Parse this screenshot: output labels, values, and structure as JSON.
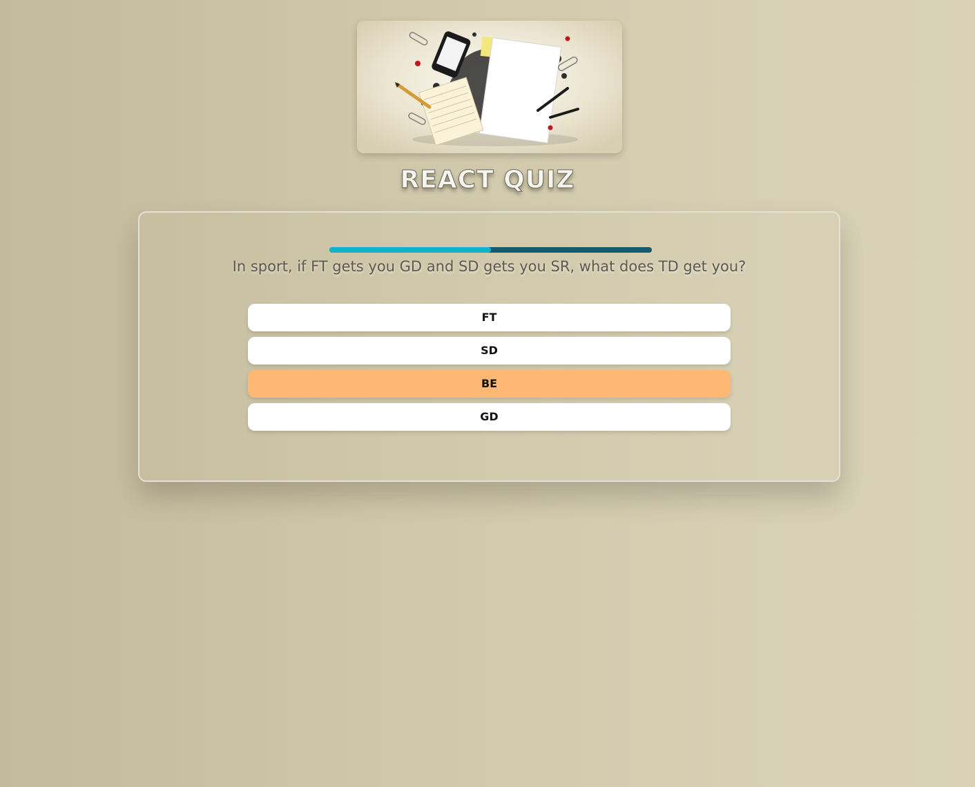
{
  "app": {
    "title": "REACT QUIZ"
  },
  "quiz": {
    "progress": 0.5,
    "question": "In sport, if FT gets you GD and SD gets you SR, what does TD get you?",
    "answers": [
      {
        "label": "FT",
        "selected": false
      },
      {
        "label": "SD",
        "selected": false
      },
      {
        "label": "BE",
        "selected": true
      },
      {
        "label": "GD",
        "selected": false
      }
    ]
  },
  "colors": {
    "progress_fill": "#13b0cf",
    "progress_track": "#195a6a",
    "selected_answer": "#fdb974",
    "answer_bg": "#ffffff"
  }
}
